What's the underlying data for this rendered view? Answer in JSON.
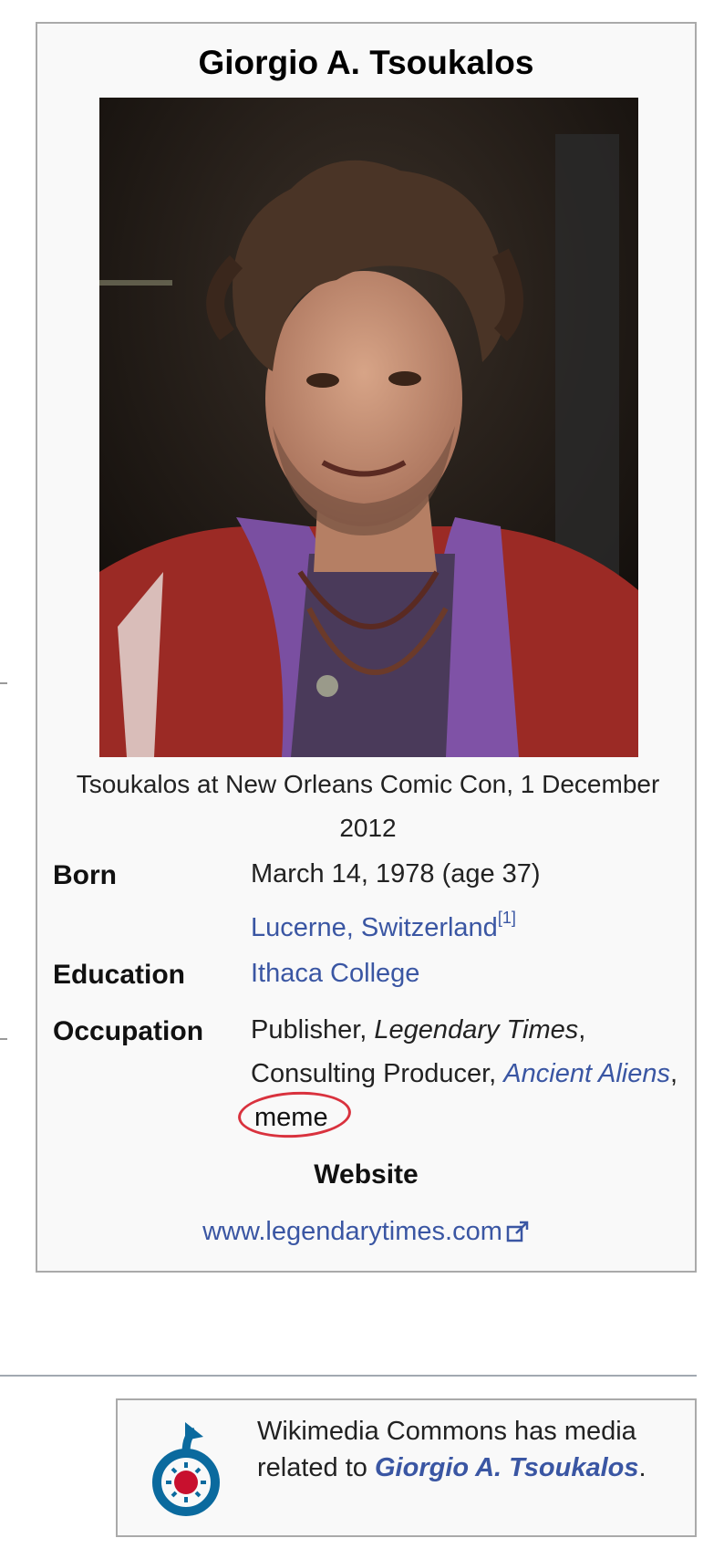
{
  "infobox": {
    "title": "Giorgio A. Tsoukalos",
    "caption": "Tsoukalos at New Orleans Comic Con, 1 December 2012",
    "born": {
      "label": "Born",
      "date": "March 14, 1978 (age 37)",
      "place": "Lucerne, Switzerland",
      "ref": "[1]"
    },
    "education": {
      "label": "Education",
      "value": "Ithaca College"
    },
    "occupation": {
      "label": "Occupation",
      "publisher": "Publisher, ",
      "legendary_times": "Legendary Times",
      "comma1": ",",
      "consulting": "Consulting Producer, ",
      "ancient_aliens": "Ancient Aliens",
      "comma2": ",",
      "meme": "meme"
    },
    "website": {
      "label": "Website",
      "url": "www.legendarytimes.com"
    }
  },
  "commons": {
    "text_before": "Wikimedia Commons has media related to ",
    "link": "Giorgio A. Tsoukalos",
    "text_after": "."
  },
  "colors": {
    "link": "#3a56a3",
    "annotation_circle": "#d9323e",
    "infobox_bg": "#f9f9f9",
    "border": "#aaaaaa"
  }
}
